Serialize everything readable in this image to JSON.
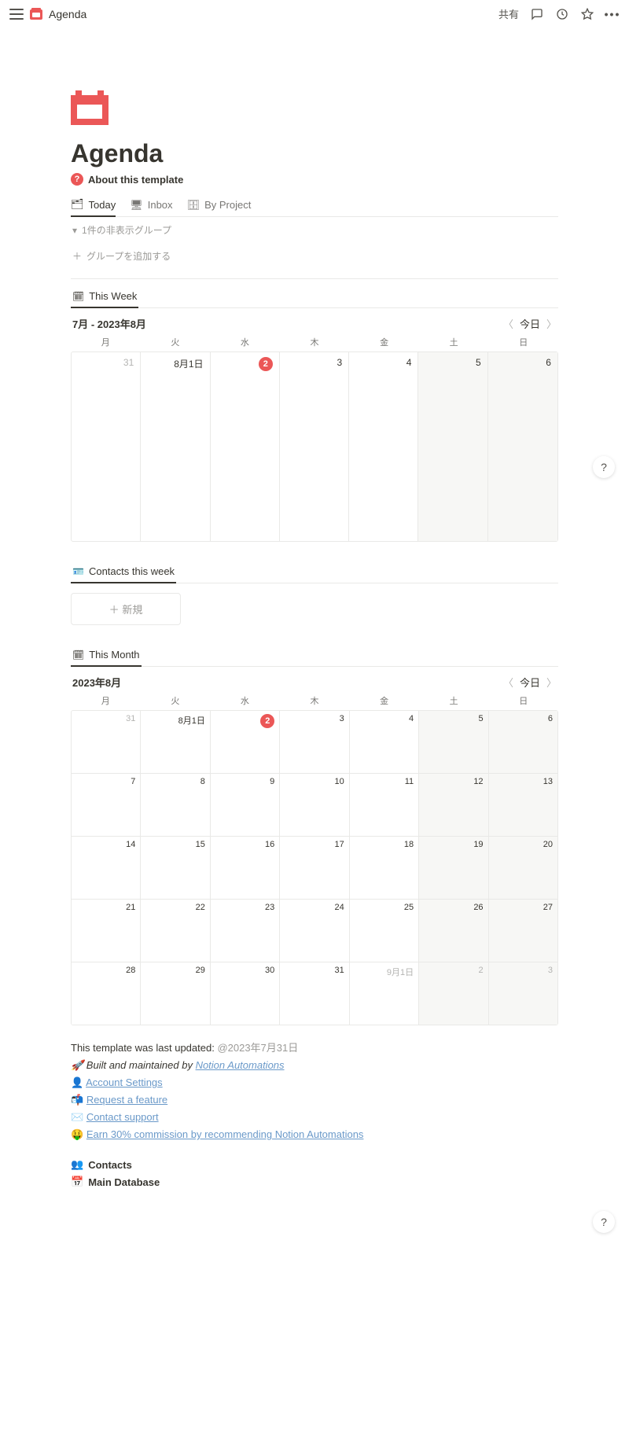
{
  "topbar": {
    "title": "Agenda",
    "share": "共有"
  },
  "page": {
    "title": "Agenda",
    "about": "About this template"
  },
  "tabs": {
    "today": "Today",
    "inbox": "Inbox",
    "byProject": "By Project"
  },
  "ghost": {
    "hiddenGroups": "1件の非表示グループ",
    "addGroup": "グループを追加する"
  },
  "thisWeek": {
    "tab": "This Week",
    "range": "7月 - 2023年8月",
    "today": "今日",
    "dow": [
      "月",
      "火",
      "水",
      "木",
      "金",
      "土",
      "日"
    ],
    "cells": [
      {
        "label": "31",
        "dim": true,
        "weekend": false
      },
      {
        "label": "8月1日",
        "dim": false,
        "weekend": false
      },
      {
        "label": "2",
        "dim": false,
        "weekend": false,
        "today": true
      },
      {
        "label": "3",
        "dim": false,
        "weekend": false
      },
      {
        "label": "4",
        "dim": false,
        "weekend": false
      },
      {
        "label": "5",
        "dim": false,
        "weekend": true
      },
      {
        "label": "6",
        "dim": false,
        "weekend": true
      }
    ]
  },
  "contactsWeek": {
    "tab": "Contacts this week",
    "new": "新規"
  },
  "thisMonth": {
    "tab": "This Month",
    "range": "2023年8月",
    "today": "今日",
    "dow": [
      "月",
      "火",
      "水",
      "木",
      "金",
      "土",
      "日"
    ],
    "cells": [
      {
        "label": "31",
        "dim": true
      },
      {
        "label": "8月1日"
      },
      {
        "label": "2",
        "today": true
      },
      {
        "label": "3"
      },
      {
        "label": "4"
      },
      {
        "label": "5",
        "weekend": true
      },
      {
        "label": "6",
        "weekend": true
      },
      {
        "label": "7"
      },
      {
        "label": "8"
      },
      {
        "label": "9"
      },
      {
        "label": "10"
      },
      {
        "label": "11"
      },
      {
        "label": "12",
        "weekend": true
      },
      {
        "label": "13",
        "weekend": true
      },
      {
        "label": "14"
      },
      {
        "label": "15"
      },
      {
        "label": "16"
      },
      {
        "label": "17"
      },
      {
        "label": "18"
      },
      {
        "label": "19",
        "weekend": true
      },
      {
        "label": "20",
        "weekend": true
      },
      {
        "label": "21"
      },
      {
        "label": "22"
      },
      {
        "label": "23"
      },
      {
        "label": "24"
      },
      {
        "label": "25"
      },
      {
        "label": "26",
        "weekend": true
      },
      {
        "label": "27",
        "weekend": true
      },
      {
        "label": "28"
      },
      {
        "label": "29"
      },
      {
        "label": "30"
      },
      {
        "label": "31"
      },
      {
        "label": "9月1日",
        "dim": true
      },
      {
        "label": "2",
        "dim": true,
        "weekend": true
      },
      {
        "label": "3",
        "dim": true,
        "weekend": true
      }
    ]
  },
  "footer": {
    "updatedPrefix": "This template was last updated: ",
    "updatedDate": "@2023年7月31日",
    "builtPrefix": "🚀 Built and maintained by ",
    "builtLink": "Notion Automations",
    "l1e": "👤",
    "l1t": "Account Settings",
    "l2e": "📬",
    "l2t": "Request a feature",
    "l3e": "✉️",
    "l3t": "Contact support",
    "l4e": "🤑",
    "l4t": "Earn 30% commission by recommending Notion Automations"
  },
  "dblinks": {
    "contacts": "Contacts",
    "mainDb": "Main Database"
  }
}
